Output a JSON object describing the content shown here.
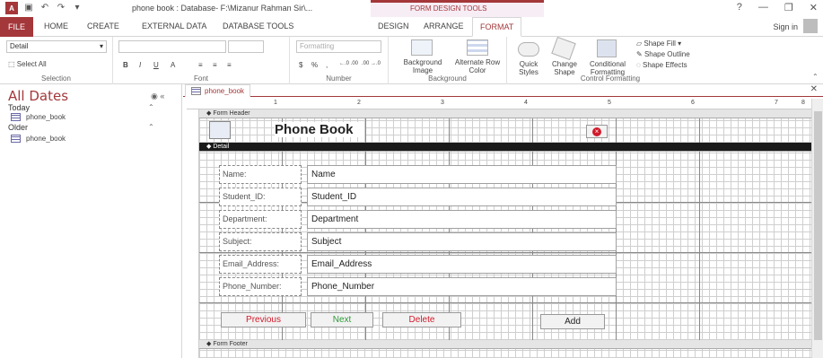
{
  "window": {
    "title": "phone book : Database- F:\\Mizanur Rahman Sir\\...",
    "contextual_group": "FORM DESIGN TOOLS",
    "controls": [
      "?",
      "—",
      "❐",
      "✕"
    ]
  },
  "tabs": {
    "file": "FILE",
    "items": [
      "HOME",
      "CREATE",
      "EXTERNAL DATA",
      "DATABASE TOOLS",
      "DESIGN",
      "ARRANGE",
      "FORMAT"
    ],
    "active": "FORMAT",
    "sign_in": "Sign in"
  },
  "ribbon": {
    "selection": {
      "combo_value": "Detail",
      "select_all": "Select All",
      "label": "Selection"
    },
    "font": {
      "bold": "B",
      "italic": "I",
      "underline": "U",
      "font_color": "A",
      "label": "Font"
    },
    "number": {
      "format_combo": "Formatting",
      "currency": "$",
      "percent": "%",
      "comma": ",",
      "inc": "←.0 .00",
      "dec": ".00 →.0",
      "label": "Number"
    },
    "background": {
      "bg_image": "Background Image",
      "alt_row": "Alternate Row Color",
      "label": "Background"
    },
    "control_formatting": {
      "quick_styles": "Quick Styles",
      "change_shape": "Change Shape",
      "conditional": "Conditional Formatting",
      "shape_fill": "Shape Fill",
      "shape_outline": "Shape Outline",
      "shape_effects": "Shape Effects",
      "label": "Control Formatting"
    }
  },
  "nav_pane": {
    "title": "All Dates",
    "groups": [
      {
        "name": "Today",
        "items": [
          "phone_book"
        ]
      },
      {
        "name": "Older",
        "items": [
          "phone_book"
        ]
      }
    ]
  },
  "document": {
    "tab_label": "phone_book",
    "ruler_numbers": [
      "1",
      "2",
      "3",
      "4",
      "5",
      "6",
      "7",
      "8"
    ],
    "sections": {
      "header": "Form Header",
      "detail": "Detail",
      "footer": "Form Footer"
    },
    "form_title": "Phone Book",
    "fields": [
      {
        "label": "Name:",
        "control": "Name"
      },
      {
        "label": "Student_ID:",
        "control": "Student_ID"
      },
      {
        "label": "Department:",
        "control": "Department"
      },
      {
        "label": "Subject:",
        "control": "Subject"
      },
      {
        "label": "Email_Address:",
        "control": "Email_Address"
      },
      {
        "label": "Phone_Number:",
        "control": "Phone_Number"
      }
    ],
    "buttons": [
      {
        "label": "Previous",
        "color": "#d11b2b"
      },
      {
        "label": "Next",
        "color": "#2e9a3a"
      },
      {
        "label": "Delete",
        "color": "#d11b2b"
      },
      {
        "label": "Add",
        "color": "#222222"
      }
    ]
  }
}
